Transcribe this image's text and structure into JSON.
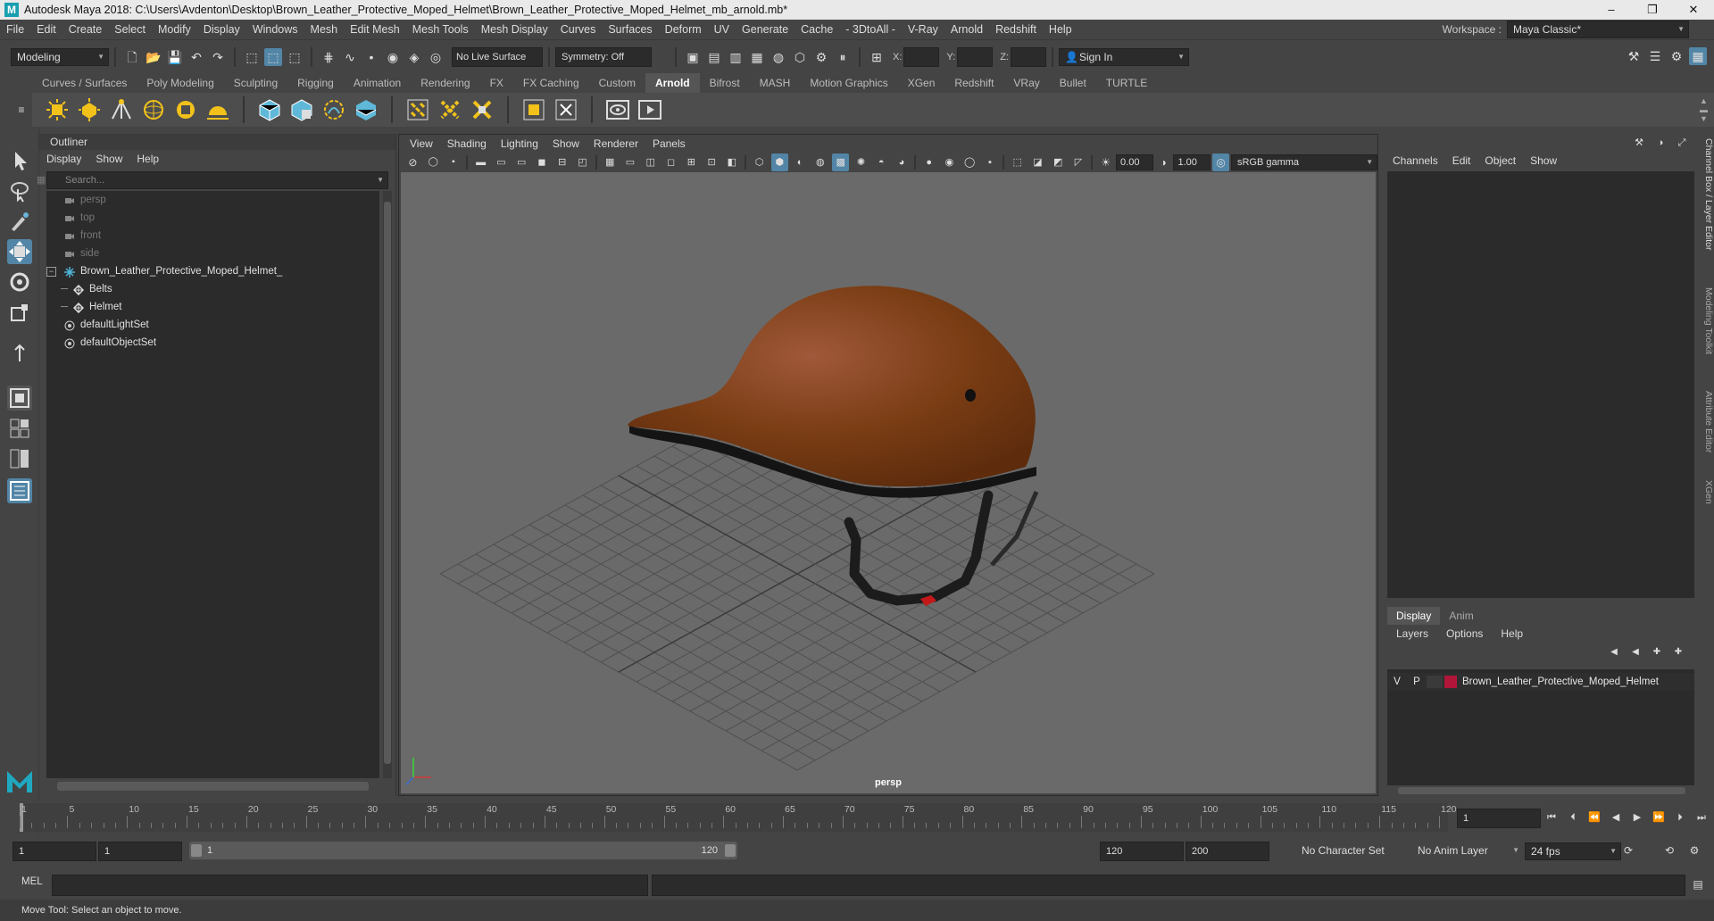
{
  "window": {
    "title": "Autodesk Maya 2018: C:\\Users\\Avdenton\\Desktop\\Brown_Leather_Protective_Moped_Helmet\\Brown_Leather_Protective_Moped_Helmet_mb_arnold.mb*",
    "logo": "M",
    "controls": [
      "–",
      "❐",
      "✕"
    ]
  },
  "menubar": {
    "items": [
      "File",
      "Edit",
      "Create",
      "Select",
      "Modify",
      "Display",
      "Windows",
      "Mesh",
      "Edit Mesh",
      "Mesh Tools",
      "Mesh Display",
      "Curves",
      "Surfaces",
      "Deform",
      "UV",
      "Generate",
      "Cache",
      "- 3DtoAll -",
      "V-Ray",
      "Arnold",
      "Redshift",
      "Help"
    ],
    "workspace_label": "Workspace :",
    "workspace_value": "Maya Classic*"
  },
  "statusline": {
    "mode": "Modeling",
    "live_surface": "No Live Surface",
    "symmetry": "Symmetry: Off",
    "x_label": "X:",
    "y_label": "Y:",
    "z_label": "Z:",
    "sign_in": "Sign In"
  },
  "shelf": {
    "tabs": [
      "Curves / Surfaces",
      "Poly Modeling",
      "Sculpting",
      "Rigging",
      "Animation",
      "Rendering",
      "FX",
      "FX Caching",
      "Custom",
      "Arnold",
      "Bifrost",
      "MASH",
      "Motion Graphics",
      "XGen",
      "Redshift",
      "VRay",
      "Bullet",
      "TURTLE"
    ],
    "active_tab": "Arnold"
  },
  "outliner": {
    "title": "Outliner",
    "menu": [
      "Display",
      "Show",
      "Help"
    ],
    "search_placeholder": "Search...",
    "items": [
      {
        "label": "persp",
        "type": "camera",
        "dim": true,
        "indent": 1
      },
      {
        "label": "top",
        "type": "camera",
        "dim": true,
        "indent": 1
      },
      {
        "label": "front",
        "type": "camera",
        "dim": true,
        "indent": 1
      },
      {
        "label": "side",
        "type": "camera",
        "dim": true,
        "indent": 1
      },
      {
        "label": "Brown_Leather_Protective_Moped_Helmet_",
        "type": "group",
        "dim": false,
        "indent": 0
      },
      {
        "label": "Belts",
        "type": "mesh",
        "dim": false,
        "indent": 2
      },
      {
        "label": "Helmet",
        "type": "mesh",
        "dim": false,
        "indent": 2
      },
      {
        "label": "defaultLightSet",
        "type": "set",
        "dim": false,
        "indent": 1
      },
      {
        "label": "defaultObjectSet",
        "type": "set",
        "dim": false,
        "indent": 1
      }
    ]
  },
  "viewport": {
    "menu": [
      "View",
      "Shading",
      "Lighting",
      "Show",
      "Renderer",
      "Panels"
    ],
    "exposure": "0.00",
    "gamma": "1.00",
    "color_space": "sRGB gamma",
    "camera": "persp",
    "colors": {
      "helmet": "#7a3d14",
      "helmet_light": "#a0593a",
      "strap": "#1c1c1c",
      "buckle": "#c41818",
      "background": "#6a6a6a",
      "grid": "#505050"
    }
  },
  "channelbox": {
    "menu": [
      "Channels",
      "Edit",
      "Object",
      "Show"
    ],
    "layer_tabs": [
      "Display",
      "Anim"
    ],
    "layer_menu": [
      "Layers",
      "Options",
      "Help"
    ],
    "layer": {
      "v": "V",
      "p": "P",
      "name": "Brown_Leather_Protective_Moped_Helmet",
      "color": "#b0163a"
    },
    "side_tabs": [
      "Channel Box / Layer Editor",
      "Modeling Toolkit",
      "Attribute Editor",
      "XGen"
    ]
  },
  "timeline": {
    "ticks": [
      "1",
      "5",
      "10",
      "15",
      "20",
      "25",
      "30",
      "35",
      "40",
      "45",
      "50",
      "55",
      "60",
      "65",
      "70",
      "75",
      "80",
      "85",
      "90",
      "95",
      "100",
      "105",
      "110",
      "115",
      "120"
    ],
    "current_frame": "1"
  },
  "range": {
    "start": "1",
    "playback_start": "1",
    "slider_start": "1",
    "slider_end": "120",
    "playback_end": "120",
    "end": "200",
    "character_set": "No Character Set",
    "anim_layer": "No Anim Layer",
    "fps": "24 fps"
  },
  "cmdline": {
    "label": "MEL"
  },
  "helpline": {
    "text": "Move Tool: Select an object to move."
  }
}
